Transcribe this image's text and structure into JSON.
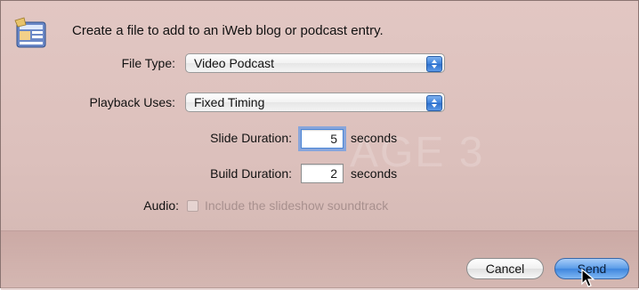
{
  "dialog": {
    "header": "Create a file to add to an iWeb blog or podcast entry.",
    "watermark": "AGE 3"
  },
  "file_type": {
    "label": "File Type:",
    "selected": "Video Podcast"
  },
  "playback": {
    "label": "Playback Uses:",
    "selected": "Fixed Timing"
  },
  "slide_duration": {
    "label": "Slide Duration:",
    "value": "5",
    "unit": "seconds"
  },
  "build_duration": {
    "label": "Build Duration:",
    "value": "2",
    "unit": "seconds"
  },
  "audio": {
    "label": "Audio:",
    "checkbox_label": "Include the slideshow soundtrack",
    "checked": false,
    "enabled": false
  },
  "buttons": {
    "cancel": "Cancel",
    "send": "Send"
  },
  "colors": {
    "sheet_background": "#dcc0bc",
    "focus_ring": "#5a96eb",
    "default_button": "#3f86de"
  }
}
